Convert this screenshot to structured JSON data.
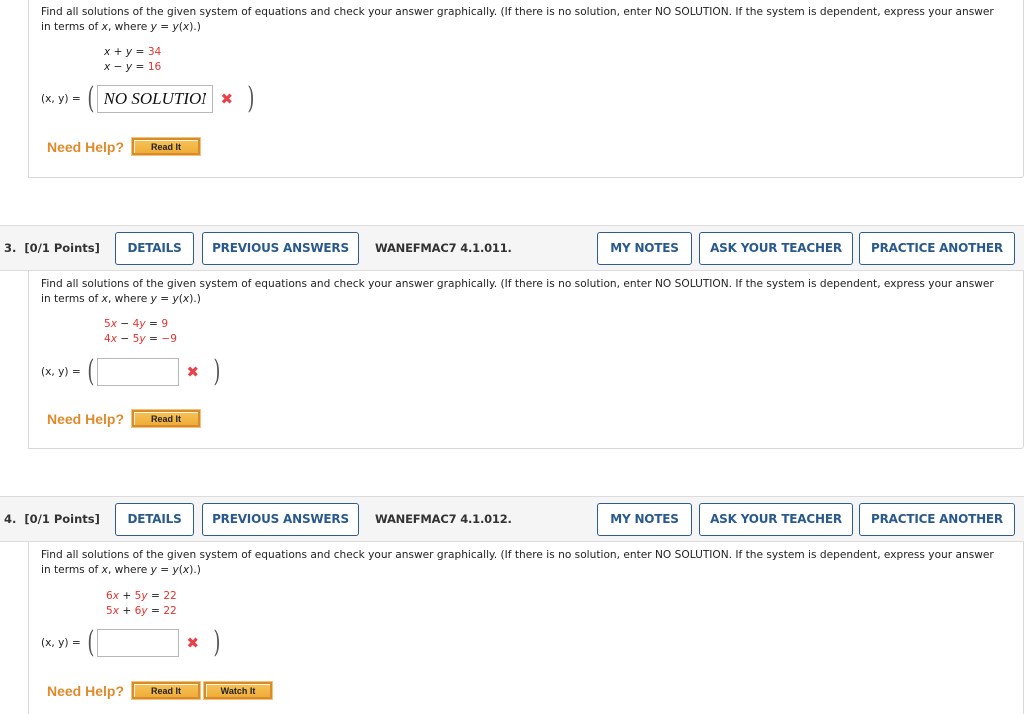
{
  "prompt_text_1": "Find all solutions of the given system of equations and check your answer graphically. (If there is no solution, enter NO SOLUTION. If the system is dependent, express your answer",
  "prompt_text_2a": "in terms of ",
  "prompt_text_2b": "x",
  "prompt_text_2c": ", where ",
  "prompt_text_2d": "y",
  "prompt_text_2e": " = ",
  "prompt_text_2f": "y",
  "prompt_text_2g": "(",
  "prompt_text_2h": "x",
  "prompt_text_2i": ").)",
  "answer_label": "(x, y) =",
  "need_help_label": "Need Help?",
  "read_it_label": "Read It",
  "watch_it_label": "Watch It",
  "wrong_mark": "✖",
  "header_buttons": {
    "details": "DETAILS",
    "previous_answers": "PREVIOUS ANSWERS",
    "my_notes": "MY NOTES",
    "ask_teacher": "ASK YOUR TEACHER",
    "practice_another": "PRACTICE ANOTHER"
  },
  "questions": [
    {
      "number": "",
      "equations": [
        {
          "lhs_coef1": "",
          "var1": "x",
          "op": " + ",
          "lhs_coef2": "",
          "var2": "y",
          "eq": " = ",
          "rhs": "34"
        },
        {
          "lhs_coef1": "",
          "var1": "x",
          "op": " − ",
          "lhs_coef2": "",
          "var2": "y",
          "eq": " = ",
          "rhs": "16"
        }
      ],
      "answer_value": "NO SOLUTION",
      "status": "incorrect"
    },
    {
      "number": "3.",
      "points": "[0/1 Points]",
      "code": "WANEFMAC7 4.1.011.",
      "equations": [
        {
          "lhs_coef1": "5",
          "var1": "x",
          "op": " − ",
          "lhs_coef2": "4",
          "var2": "y",
          "eq": " = ",
          "rhs": "9"
        },
        {
          "lhs_coef1": "4",
          "var1": "x",
          "op": " − ",
          "lhs_coef2": "5",
          "var2": "y",
          "eq": " = ",
          "rhs": "−9"
        }
      ],
      "answer_value": "",
      "status": "incorrect"
    },
    {
      "number": "4.",
      "points": "[0/1 Points]",
      "code": "WANEFMAC7 4.1.012.",
      "equations": [
        {
          "lhs_coef1": "6",
          "var1": "x",
          "op": " + ",
          "lhs_coef2": "5",
          "var2": "y",
          "eq": " = ",
          "rhs": "22"
        },
        {
          "lhs_coef1": "5",
          "var1": "x",
          "op": " + ",
          "lhs_coef2": "6",
          "var2": "y",
          "eq": " = ",
          "rhs": "22"
        }
      ],
      "answer_value": "",
      "status": "incorrect"
    }
  ],
  "colors": {
    "accent_blue": "#2a5a8c",
    "help_orange": "#e08a2b",
    "coef_red": "#e3342f",
    "wrong_red": "#e8424a"
  }
}
